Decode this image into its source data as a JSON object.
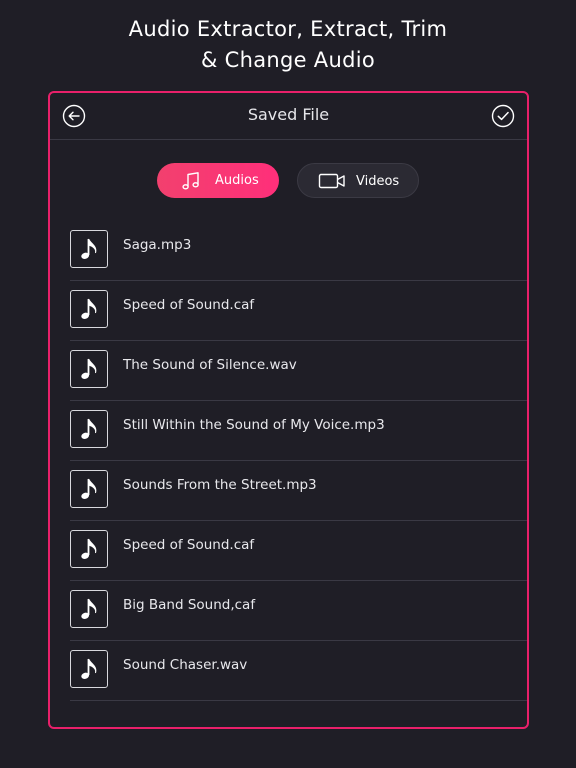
{
  "headline": {
    "line1": "Audio Extractor, Extract, Trim",
    "line2": "& Change Audio"
  },
  "panel": {
    "title": "Saved File",
    "back_icon": "back-arrow-circle-icon",
    "done_icon": "checkmark-circle-icon"
  },
  "tabs": [
    {
      "label": "Audios",
      "icon": "music-note-icon",
      "active": true
    },
    {
      "label": "Videos",
      "icon": "video-camera-icon",
      "active": false
    }
  ],
  "files": [
    {
      "name": "Saga.mp3"
    },
    {
      "name": "Speed of Sound.caf"
    },
    {
      "name": "The Sound of Silence.wav"
    },
    {
      "name": "Still Within the Sound of My Voice.mp3"
    },
    {
      "name": "Sounds From the Street.mp3"
    },
    {
      "name": "Speed of Sound.caf"
    },
    {
      "name": "Big Band Sound,caf"
    },
    {
      "name": "Sound Chaser.wav"
    }
  ],
  "colors": {
    "accent": "#e8206a",
    "background": "#1f1e26",
    "tab_active": "#ff2f7a"
  }
}
